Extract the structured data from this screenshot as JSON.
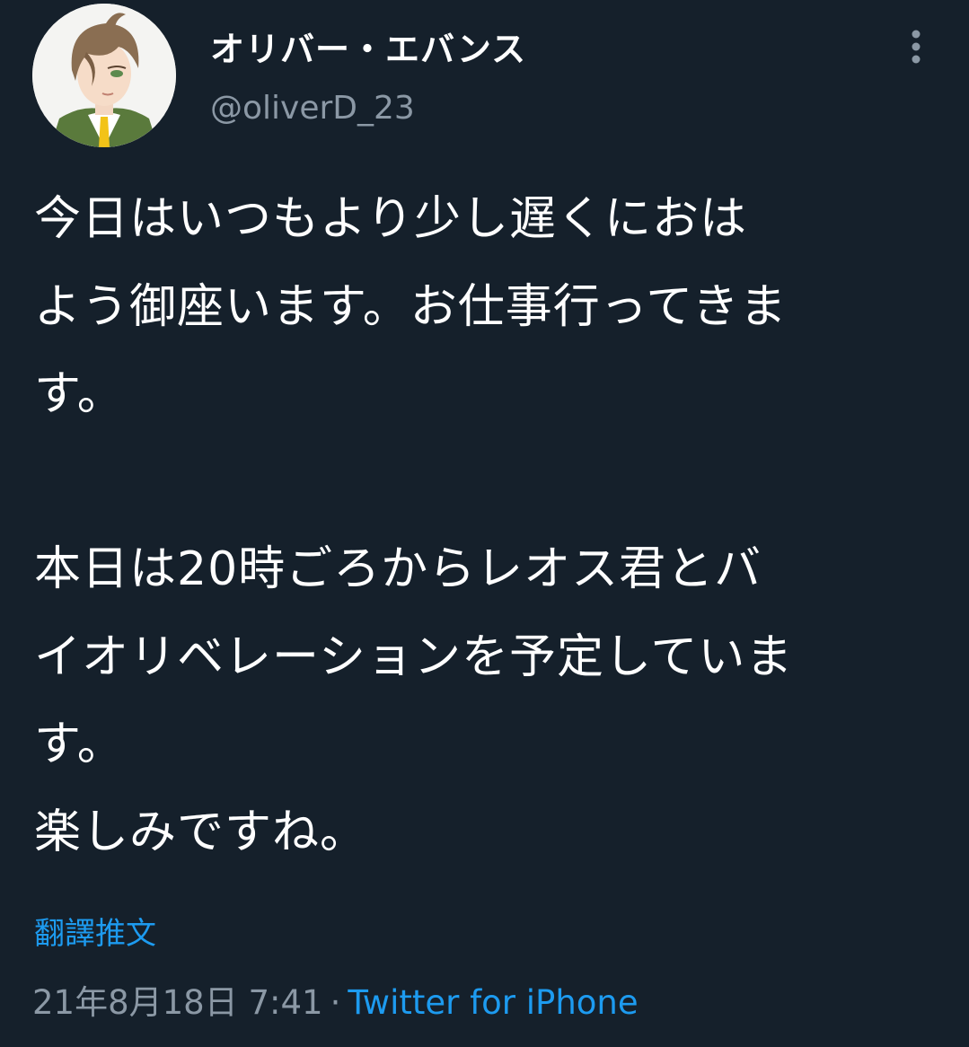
{
  "user": {
    "display_name": "オリバー・エバンス",
    "handle": "@oliverD_23",
    "avatar_icon": "avatar-illustration"
  },
  "tweet": {
    "text": "今日はいつもより少し遅くにおは\nよう御座います。お仕事行ってきま\nす。\n\n本日は20時ごろからレオス君とバ\nイオリベレーションを予定していま\nす。\n楽しみですね。",
    "translate_label": "翻譯推文",
    "timestamp": "21年8月18日 7:41",
    "separator": "·",
    "source": "Twitter for iPhone"
  },
  "icons": {
    "more": "more-vertical-icon"
  },
  "colors": {
    "background": "#15202b",
    "accent": "#1d9bf0",
    "secondary_text": "#8b98a5",
    "primary_text": "#ffffff"
  }
}
